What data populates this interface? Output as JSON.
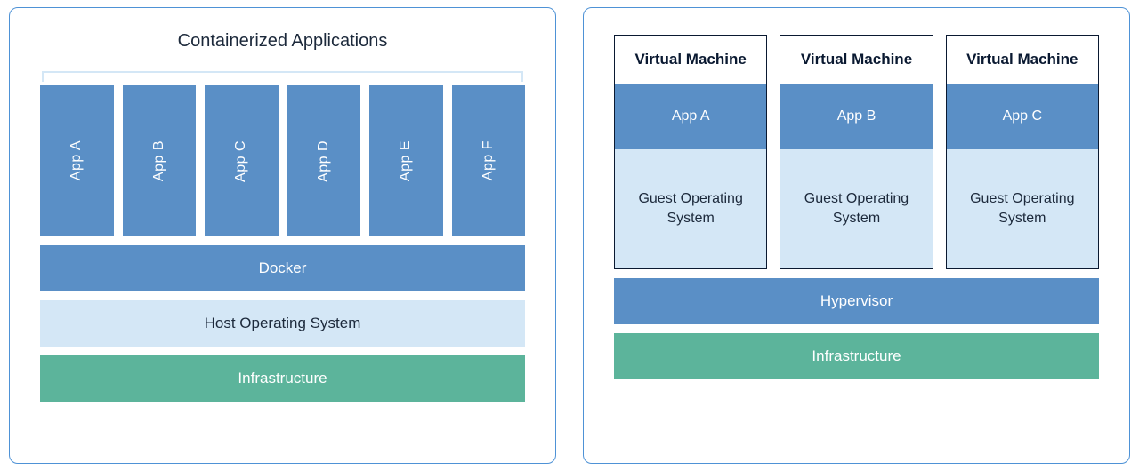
{
  "left": {
    "title": "Containerized Applications",
    "apps": [
      "App A",
      "App B",
      "App C",
      "App D",
      "App E",
      "App F"
    ],
    "docker": "Docker",
    "hostos": "Host Operating System",
    "infra": "Infrastructure"
  },
  "right": {
    "vms": [
      {
        "title": "Virtual Machine",
        "app": "App A",
        "guest": "Guest Operating System"
      },
      {
        "title": "Virtual Machine",
        "app": "App B",
        "guest": "Guest Operating System"
      },
      {
        "title": "Virtual Machine",
        "app": "App C",
        "guest": "Guest Operating System"
      }
    ],
    "hypervisor": "Hypervisor",
    "infra": "Infrastructure"
  }
}
